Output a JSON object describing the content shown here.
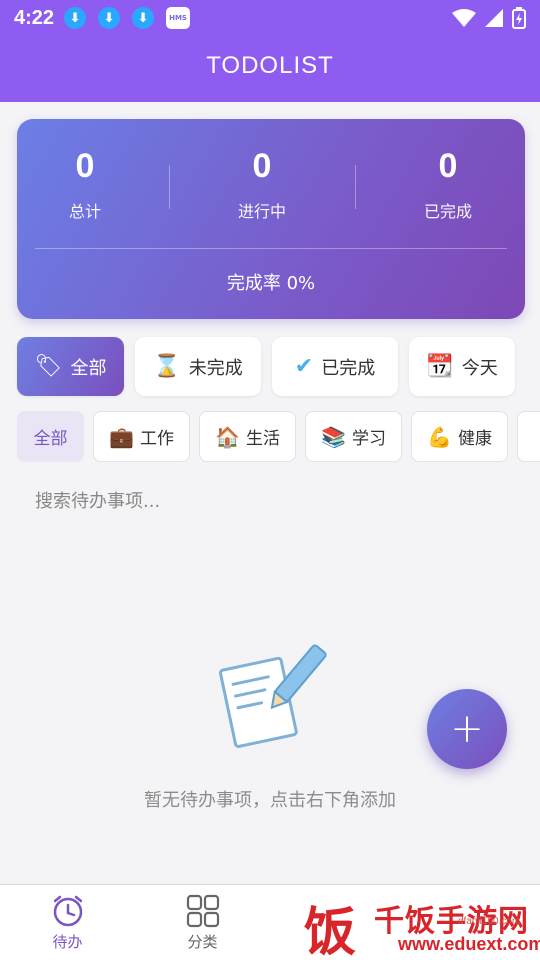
{
  "status_bar": {
    "time": "4:22",
    "hms_label": "HMS"
  },
  "app_bar": {
    "title": "TODOLIST",
    "accent": "#8e5cf0"
  },
  "stats": {
    "total": {
      "value": "0",
      "label": "总计"
    },
    "in_progress": {
      "value": "0",
      "label": "进行中"
    },
    "completed": {
      "value": "0",
      "label": "已完成"
    },
    "completion_rate": "完成率 0%"
  },
  "filters": [
    {
      "label": "全部",
      "icon": "tag-icon",
      "active": true
    },
    {
      "label": "未完成",
      "icon": "hourglass-icon",
      "active": false
    },
    {
      "label": "已完成",
      "icon": "checkmark-icon",
      "active": false
    },
    {
      "label": "今天",
      "icon": "calendar-icon",
      "active": false
    }
  ],
  "categories": [
    {
      "label": "全部",
      "icon": "",
      "active": true
    },
    {
      "label": "工作",
      "icon": "briefcase-icon",
      "active": false
    },
    {
      "label": "生活",
      "icon": "house-icon",
      "active": false
    },
    {
      "label": "学习",
      "icon": "books-icon",
      "active": false
    },
    {
      "label": "健康",
      "icon": "flexed-arm-icon",
      "active": false
    }
  ],
  "search": {
    "placeholder": "搜索待办事项..."
  },
  "empty_state": {
    "message": "暂无待办事项，点击右下角添加",
    "icon": "note-pencil-icon"
  },
  "fab": {
    "label": "+"
  },
  "bottom_nav": [
    {
      "label": "待办",
      "icon": "alarm-clock-icon",
      "active": true
    },
    {
      "label": "分类",
      "icon": "grid-icon",
      "active": false
    }
  ],
  "watermark": {
    "logo": "饭",
    "text": "千饭手游网",
    "url": "www.eduext.com",
    "small": "dfanji100.com"
  }
}
